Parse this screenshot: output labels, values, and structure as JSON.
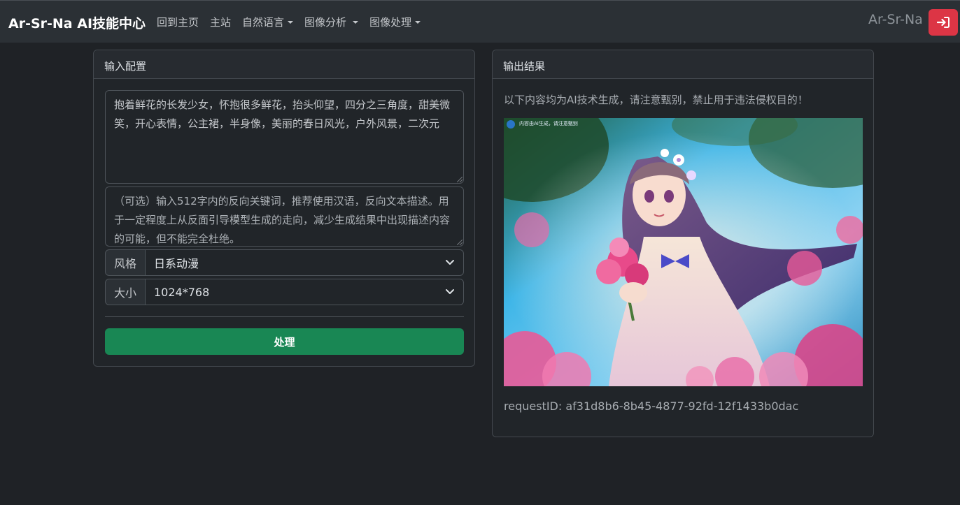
{
  "navbar": {
    "brand": "Ar-Sr-Na AI技能中心",
    "items": [
      {
        "label": "回到主页",
        "dropdown": false
      },
      {
        "label": "主站",
        "dropdown": false
      },
      {
        "label": "自然语言",
        "dropdown": true
      },
      {
        "label": "图像分析",
        "dropdown": true
      },
      {
        "label": "图像处理",
        "dropdown": true
      }
    ],
    "user": "Ar-Sr-Na",
    "logout_icon": "sign-out-icon"
  },
  "input_card": {
    "title": "输入配置",
    "prompt_value": "抱着鲜花的长发少女，怀抱很多鲜花，抬头仰望，四分之三角度，甜美微笑，开心表情，公主裙，半身像，美丽的春日风光，户外风景，二次元",
    "negative_placeholder": "（可选）输入512字内的反向关键词，推荐使用汉语，反向文本描述。用于一定程度上从反面引导模型生成的走向，减少生成结果中出现描述内容的可能，但不能完全杜绝。",
    "style_label": "风格",
    "style_value": "日系动漫",
    "size_label": "大小",
    "size_value": "1024*768",
    "submit_label": "处理"
  },
  "output_card": {
    "title": "输出结果",
    "notice": "以下内容均为AI技术生成，请注意甄别，禁止用于违法侵权目的！",
    "image_watermark": "内容由AI生成，请注意甄别",
    "request_label": "requestID:",
    "request_id": "af31d8b6-8b45-4877-92fd-12f1433b0dac"
  },
  "colors": {
    "navbar_bg": "#2b3035",
    "page_bg": "#1f2226",
    "submit_green": "#198754",
    "logout_red": "#dc3545"
  }
}
